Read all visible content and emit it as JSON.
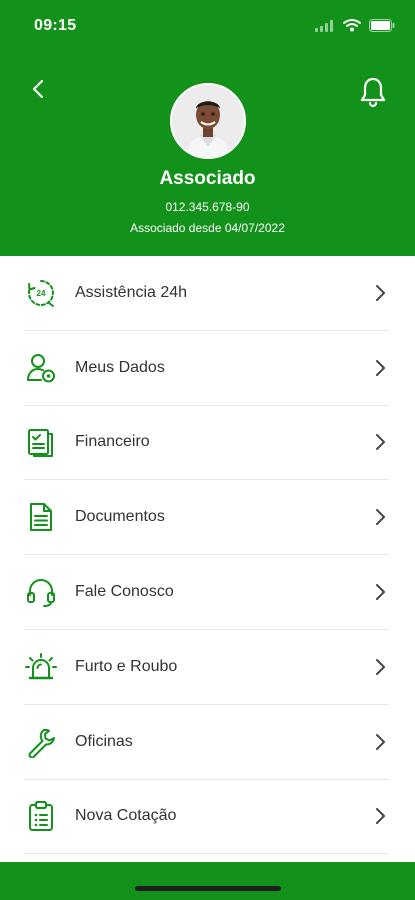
{
  "status_bar": {
    "time": "09:15"
  },
  "profile": {
    "name": "Associado",
    "id_number": "012.345.678-90",
    "since": "Associado desde 04/07/2022"
  },
  "menu": {
    "items": [
      {
        "label": "Assistência 24h",
        "icon": "24h-clock-icon"
      },
      {
        "label": "Meus Dados",
        "icon": "user-settings-icon"
      },
      {
        "label": "Financeiro",
        "icon": "invoice-icon"
      },
      {
        "label": "Documentos",
        "icon": "document-icon"
      },
      {
        "label": "Fale Conosco",
        "icon": "headset-icon"
      },
      {
        "label": "Furto e Roubo",
        "icon": "alarm-siren-icon"
      },
      {
        "label": "Oficinas",
        "icon": "wrench-icon"
      },
      {
        "label": "Nova Cotação",
        "icon": "clipboard-list-icon"
      }
    ]
  },
  "colors": {
    "brand_green": "#12921a",
    "icon_green": "#12921a",
    "text": "#333333"
  }
}
